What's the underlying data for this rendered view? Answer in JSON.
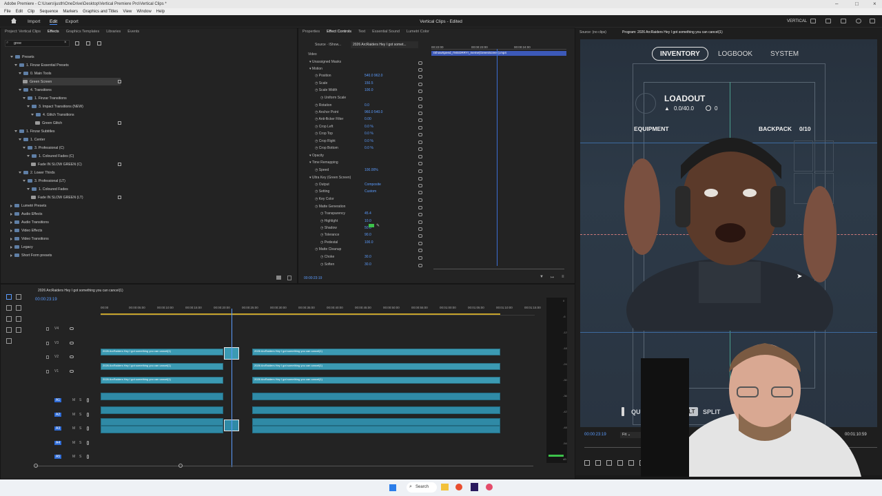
{
  "titlebar": {
    "title": "Adobe Premiere - C:\\Users\\justh\\OneDrive\\Desktop\\Vertical Premiere Pro\\Vertical Clips *"
  },
  "menu": [
    "File",
    "Edit",
    "Clip",
    "Sequence",
    "Markers",
    "Graphics and Titles",
    "View",
    "Window",
    "Help"
  ],
  "header": {
    "import": "Import",
    "edit": "Edit",
    "export": "Export",
    "project_title": "Vertical Clips - Edited",
    "workspace": "VERTICAL"
  },
  "effects_panel": {
    "tabs": [
      "Project: Vertical Clips",
      "Effects",
      "Graphics Templates",
      "Libraries",
      "Events"
    ],
    "search_value": "gree",
    "tree": [
      {
        "label": "Presets",
        "indent": 0,
        "kind": "folder",
        "open": true
      },
      {
        "label": "1. Finzar Essential Presets",
        "indent": 1,
        "kind": "folder",
        "open": true
      },
      {
        "label": "0. Main Tools",
        "indent": 2,
        "kind": "folder",
        "open": true
      },
      {
        "label": "Green Screen",
        "indent": 3,
        "kind": "fx",
        "selected": true,
        "badge": true
      },
      {
        "label": "4. Transitions",
        "indent": 2,
        "kind": "folder",
        "open": true
      },
      {
        "label": "1. Finzar Transitions",
        "indent": 3,
        "kind": "folder",
        "open": true
      },
      {
        "label": "3. Impact Transitions (NEW)",
        "indent": 4,
        "kind": "folder",
        "open": true
      },
      {
        "label": "4. Glitch Transitions",
        "indent": 5,
        "kind": "folder",
        "open": true
      },
      {
        "label": "Green Glitch",
        "indent": 6,
        "kind": "fx",
        "badge": true
      },
      {
        "label": "1. Finzar Subtitles",
        "indent": 1,
        "kind": "folder",
        "open": true
      },
      {
        "label": "1. Center",
        "indent": 2,
        "kind": "folder",
        "open": true
      },
      {
        "label": "3. Professional (C)",
        "indent": 3,
        "kind": "folder",
        "open": true
      },
      {
        "label": "1. Coloured Fades (C)",
        "indent": 4,
        "kind": "folder",
        "open": true
      },
      {
        "label": "Fade IN SLOW GREEN (C)",
        "indent": 5,
        "kind": "fx",
        "badge": true
      },
      {
        "label": "2. Lower Thirds",
        "indent": 2,
        "kind": "folder",
        "open": true
      },
      {
        "label": "3. Professional (LT)",
        "indent": 3,
        "kind": "folder",
        "open": true
      },
      {
        "label": "1. Coloured Fades",
        "indent": 4,
        "kind": "folder",
        "open": true
      },
      {
        "label": "Fade IN SLOW GREEN (LT)",
        "indent": 5,
        "kind": "fx",
        "badge": true
      },
      {
        "label": "Lumetri Presets",
        "indent": 0,
        "kind": "folder",
        "open": false
      },
      {
        "label": "Audio Effects",
        "indent": 0,
        "kind": "folder",
        "open": false
      },
      {
        "label": "Audio Transitions",
        "indent": 0,
        "kind": "folder",
        "open": false
      },
      {
        "label": "Video Effects",
        "indent": 0,
        "kind": "folder",
        "open": false
      },
      {
        "label": "Video Transitions",
        "indent": 0,
        "kind": "folder",
        "open": false
      },
      {
        "label": "Legacy",
        "indent": 0,
        "kind": "folder",
        "open": false
      },
      {
        "label": "Short Form presets",
        "indent": 0,
        "kind": "folder",
        "open": false
      }
    ]
  },
  "effect_controls": {
    "tabs": [
      "Properties",
      "Effect Controls",
      "Text",
      "Essential Sound",
      "Lumetri Color"
    ],
    "source": "Source · IShow...",
    "sequence": "2026 ArcRaiders Hey I got somet...",
    "ruler": [
      "00:22:00",
      "00:00:23:00",
      "00:00:24:00"
    ],
    "clip_name": "IShowSpeed_I'MSORRY!_meme(GreenScreen).mp4",
    "section_video": "Video",
    "rows": [
      {
        "label": "Unassigned Masks",
        "value": "",
        "indent": 1
      },
      {
        "label": "Motion",
        "value": "",
        "indent": 1
      },
      {
        "label": "Position",
        "value": "540.0    962.0",
        "indent": 2
      },
      {
        "label": "Scale",
        "value": "150.5",
        "indent": 2
      },
      {
        "label": "Scale Width",
        "value": "100.0",
        "indent": 2
      },
      {
        "label": "Uniform Scale",
        "value": "",
        "indent": 3
      },
      {
        "label": "Rotation",
        "value": "0.0",
        "indent": 2
      },
      {
        "label": "Anchor Point",
        "value": "960.0    540.0",
        "indent": 2
      },
      {
        "label": "Anti-flicker Filter",
        "value": "0.00",
        "indent": 2
      },
      {
        "label": "Crop Left",
        "value": "0.0 %",
        "indent": 2
      },
      {
        "label": "Crop Top",
        "value": "0.0 %",
        "indent": 2
      },
      {
        "label": "Crop Right",
        "value": "0.0 %",
        "indent": 2
      },
      {
        "label": "Crop Bottom",
        "value": "0.0 %",
        "indent": 2
      },
      {
        "label": "Opacity",
        "value": "",
        "indent": 1
      },
      {
        "label": "Time Remapping",
        "value": "",
        "indent": 1
      },
      {
        "label": "Speed",
        "value": "100.00%",
        "indent": 2
      },
      {
        "label": "Ultra Key (Green Screen)",
        "value": "",
        "indent": 1
      },
      {
        "label": "Output",
        "value": "Composite",
        "indent": 2
      },
      {
        "label": "Setting",
        "value": "Custom",
        "indent": 2
      },
      {
        "label": "Key Color",
        "value": "",
        "indent": 2
      },
      {
        "label": "Matte Generation",
        "value": "",
        "indent": 2
      },
      {
        "label": "Transparency",
        "value": "45.4",
        "indent": 3
      },
      {
        "label": "Highlight",
        "value": "10.0",
        "indent": 3
      },
      {
        "label": "Shadow",
        "value": "50.0",
        "indent": 3
      },
      {
        "label": "Tolerance",
        "value": "90.0",
        "indent": 3
      },
      {
        "label": "Pedestal",
        "value": "100.0",
        "indent": 3
      },
      {
        "label": "Matte Cleanup",
        "value": "",
        "indent": 2
      },
      {
        "label": "Choke",
        "value": "30.0",
        "indent": 3
      },
      {
        "label": "Soften",
        "value": "30.0",
        "indent": 3
      }
    ],
    "timecode": "00:00:23:19"
  },
  "timeline": {
    "sequence_tab": "2026 ArcRaiders Hey I got something you can cancel(1)",
    "timecode": "00:00:23:19",
    "ruler": [
      "00:00",
      "00:00:05:00",
      "00:00:10:00",
      "00:00:15:00",
      "00:00:20:00",
      "00:00:25:00",
      "00:00:30:00",
      "00:00:35:00",
      "00:00:40:00",
      "00:00:45:00",
      "00:00:50:00",
      "00:00:55:00",
      "00:01:00:00",
      "00:01:05:00",
      "00:01:10:00",
      "00:01:15:00"
    ],
    "video_tracks": [
      "V4",
      "V3",
      "V2",
      "V1"
    ],
    "audio_tracks": [
      "A1",
      "A2",
      "A3",
      "A4",
      "A5"
    ],
    "clip_label": "2026 ArcRaiders Hey I got something you can cancel(1)",
    "meter_ticks": [
      "0",
      "-6",
      "-12",
      "-18",
      "-24",
      "-30",
      "-36",
      "-42",
      "-48",
      "-54",
      "dB"
    ]
  },
  "source_monitor": {
    "label": "Source: (no clips)"
  },
  "program_monitor": {
    "label": "Program: 2026 ArcRaiders Hey I got something you can cancel(1)",
    "timecode": "00:00:23:19",
    "fit": "Fit",
    "end_timecode": "00:01:10:59"
  },
  "game_ui": {
    "tab_inventory": "INVENTORY",
    "tab_logbook": "LOGBOOK",
    "tab_system": "SYSTEM",
    "loadout": "LOADOUT",
    "weight": "0.0/40.0",
    "coins": "0",
    "equipment": "EQUIPMENT",
    "backpack": "BACKPACK",
    "backpack_count": "0/10",
    "quick_move": "QUICK MOVE",
    "alt_key": "ALT",
    "split": "SPLIT"
  },
  "taskbar": {
    "search": "Search"
  },
  "colors": {
    "accent": "#4a90ff",
    "clip_video": "#3b9ab3",
    "clip_audio": "#2f8aa6",
    "key_color": "#3cc24a"
  }
}
